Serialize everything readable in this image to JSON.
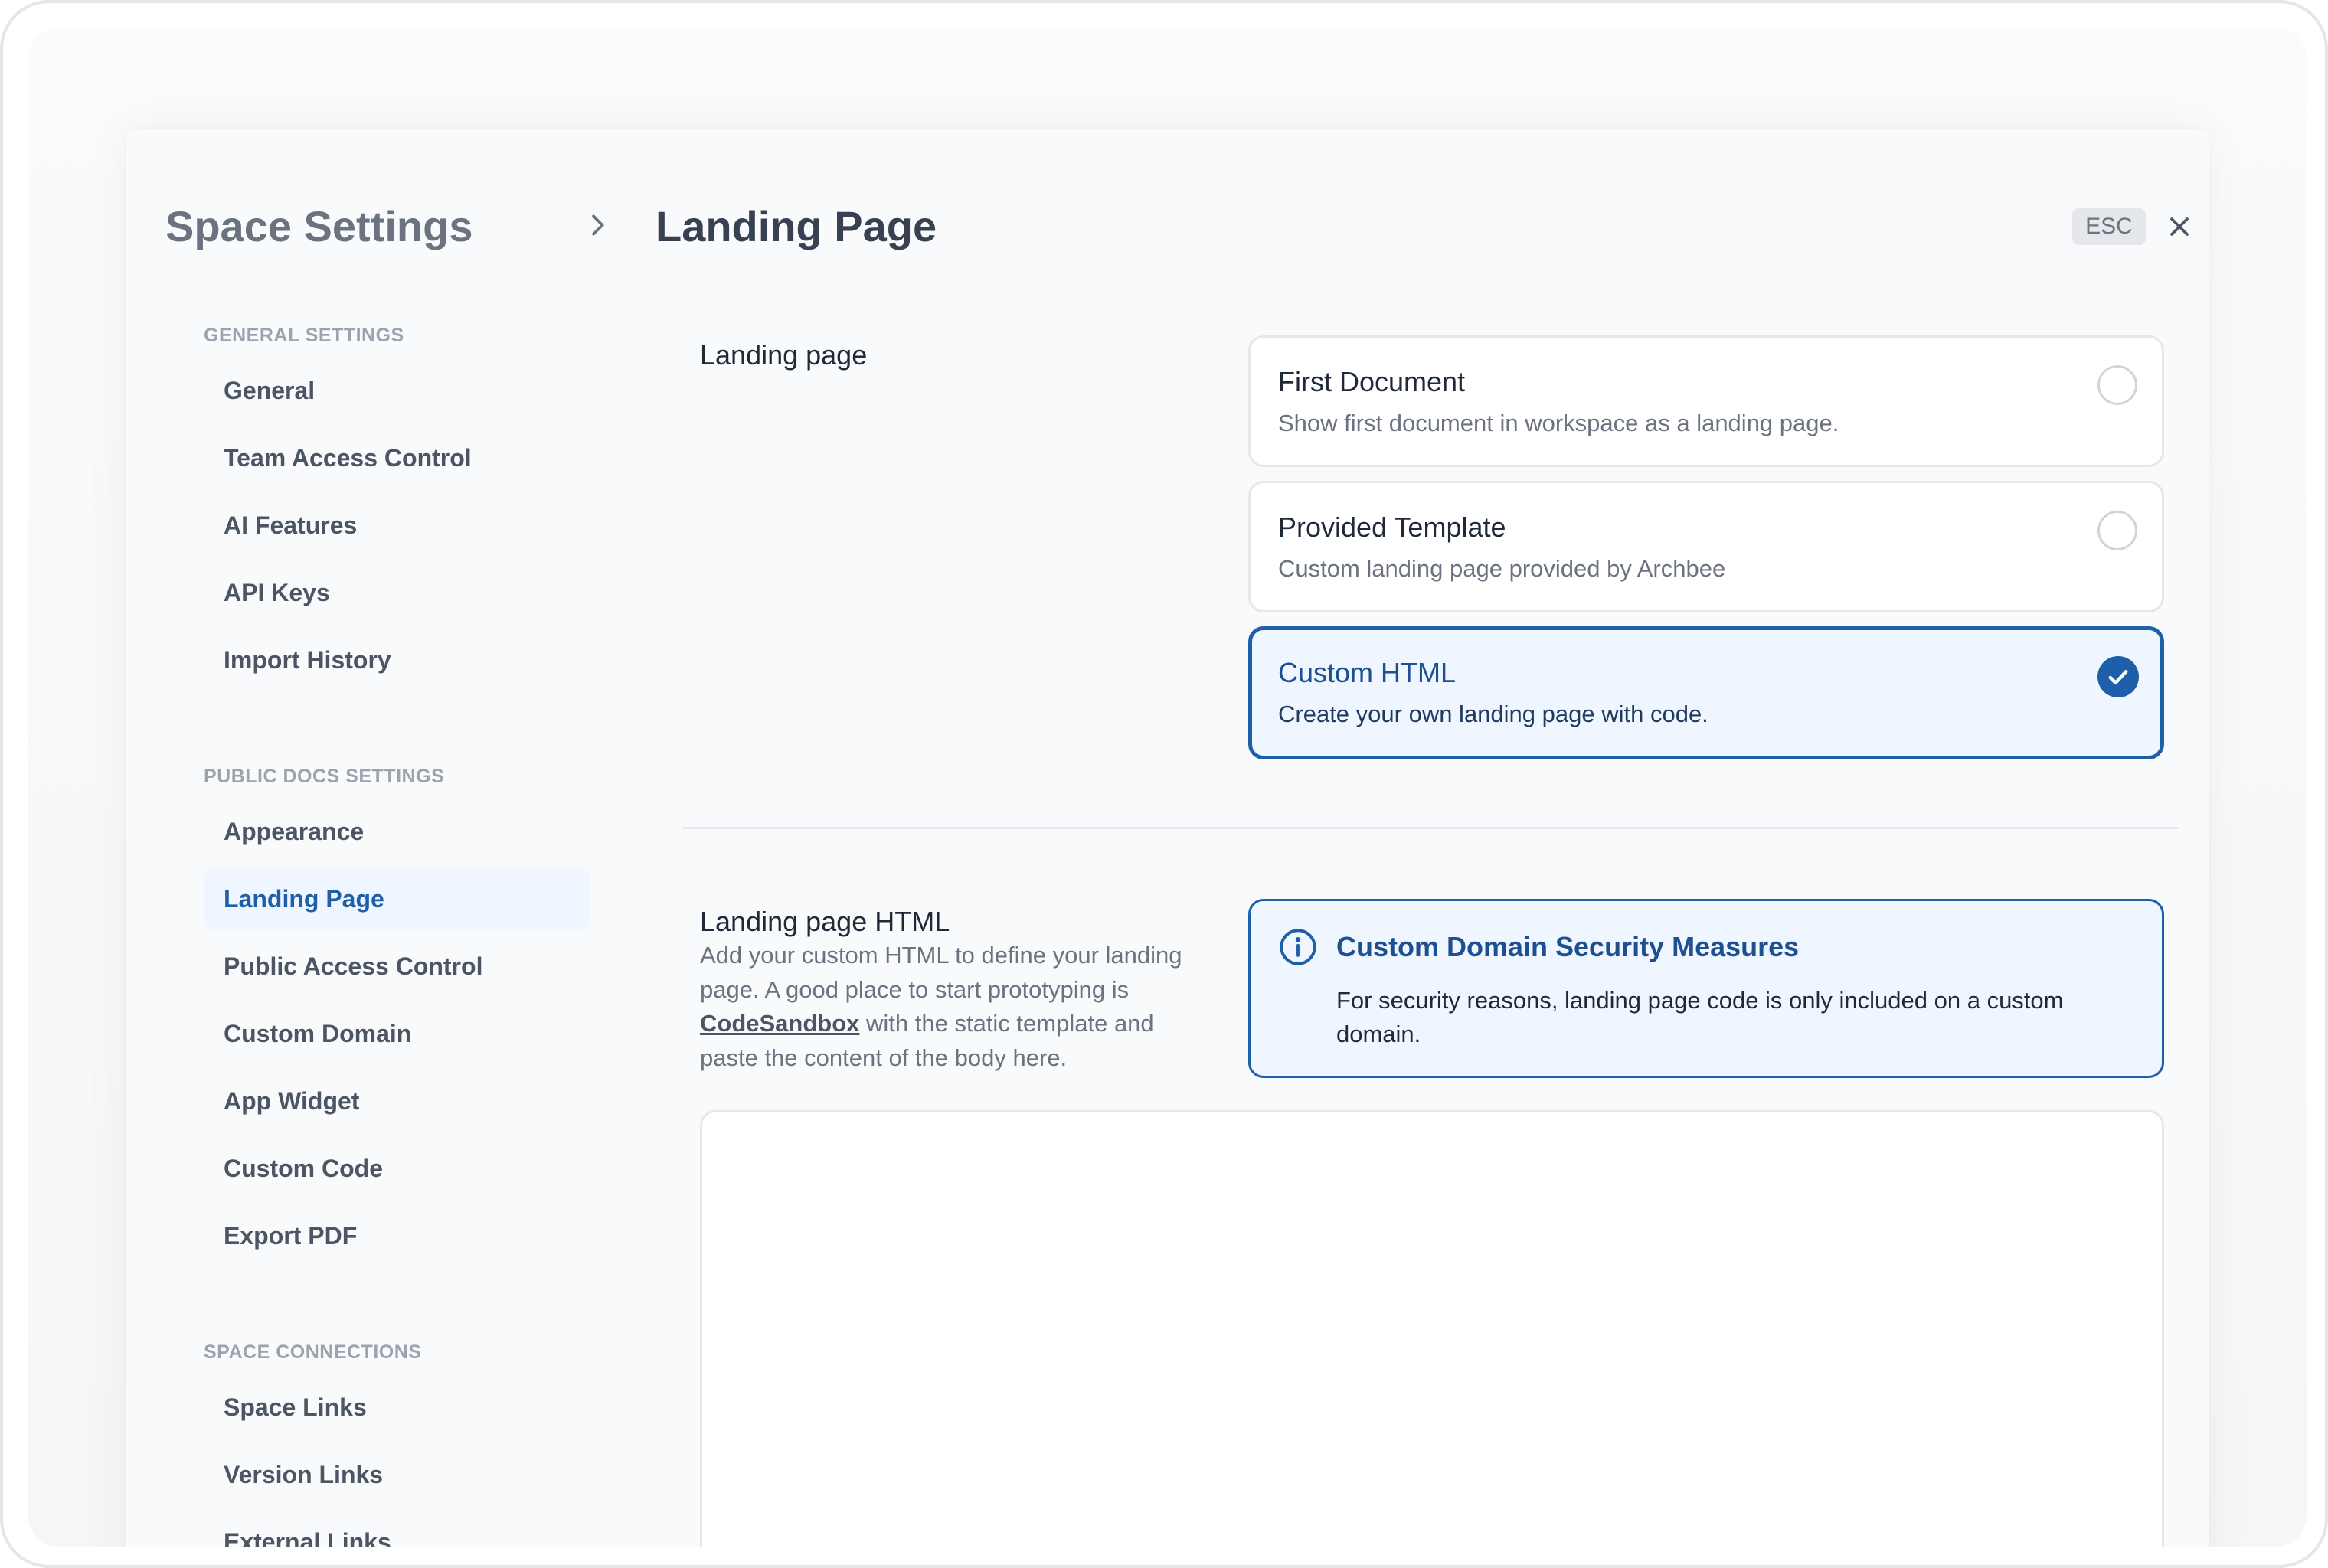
{
  "header": {
    "parent_title": "Space Settings",
    "page_title": "Landing Page",
    "esc_label": "ESC"
  },
  "sidebar": {
    "groups": [
      {
        "heading": "GENERAL SETTINGS",
        "items": [
          "General",
          "Team Access Control",
          "AI Features",
          "API Keys",
          "Import History"
        ]
      },
      {
        "heading": "PUBLIC DOCS SETTINGS",
        "items": [
          "Appearance",
          "Landing Page",
          "Public Access Control",
          "Custom Domain",
          "App Widget",
          "Custom Code",
          "Export PDF"
        ]
      },
      {
        "heading": "SPACE CONNECTIONS",
        "items": [
          "Space Links",
          "Version Links",
          "External Links"
        ]
      }
    ],
    "active_item": "Landing Page"
  },
  "landing": {
    "label": "Landing page",
    "options": [
      {
        "title": "First Document",
        "description": "Show first document in workspace as a landing page.",
        "selected": false
      },
      {
        "title": "Provided Template",
        "description": "Custom landing page provided by Archbee",
        "selected": false
      },
      {
        "title": "Custom HTML",
        "description": "Create your own landing page with code.",
        "selected": true
      }
    ]
  },
  "html_section": {
    "label": "Landing page HTML",
    "help_before": "Add your custom HTML to define your landing page. A good place to start prototyping is ",
    "help_link": "CodeSandbox",
    "help_after": " with the static template and paste the content of the body here.",
    "editor_value": ""
  },
  "info_box": {
    "title": "Custom Domain Security Measures",
    "text": "For security reasons, landing page code is only included on a custom domain."
  },
  "colors": {
    "accent": "#1d5fa8",
    "accent_bg": "#eff6ff",
    "border": "#e5e7eb",
    "muted_text": "#6b7280"
  },
  "icons": {
    "breadcrumb": "chevron-right-icon",
    "close": "close-icon",
    "info": "info-circle-icon",
    "check": "check-icon"
  }
}
